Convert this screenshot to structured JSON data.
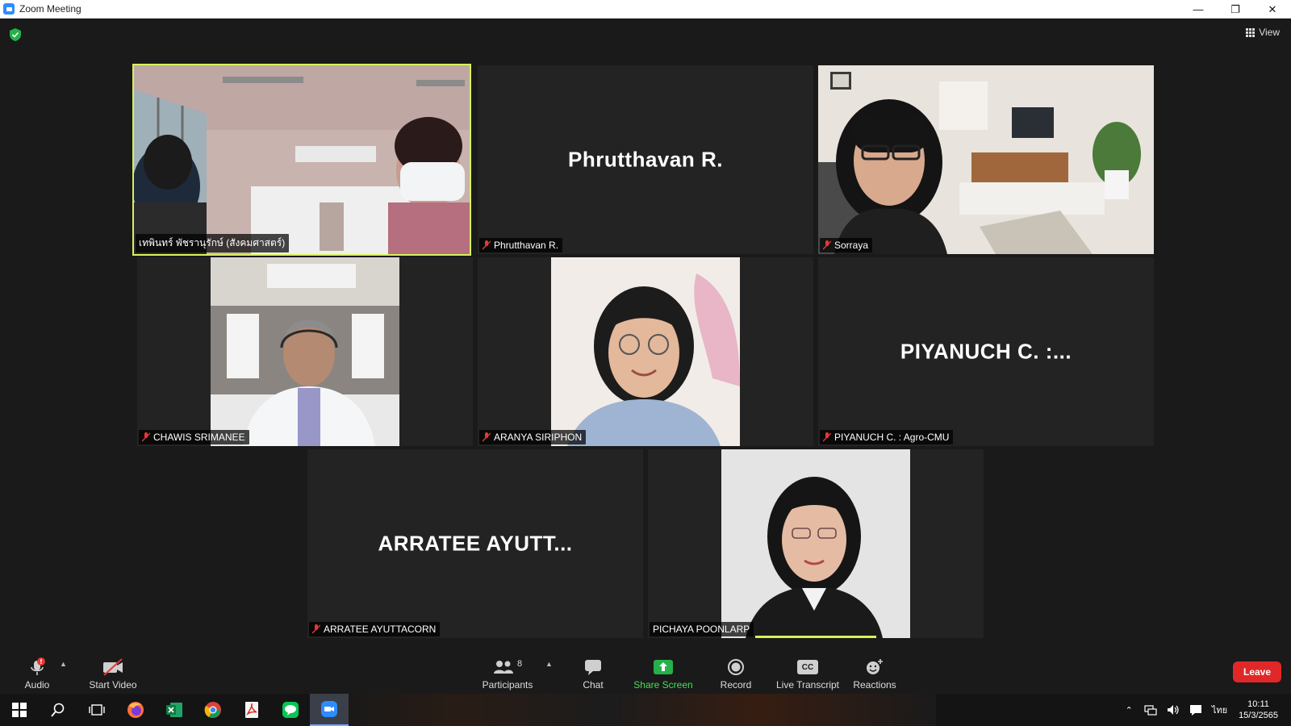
{
  "window": {
    "title": "Zoom Meeting",
    "controls": [
      "—",
      "❐",
      "✕"
    ]
  },
  "header": {
    "view_label": "View"
  },
  "participants_tiles": [
    {
      "name": "เทพินทร์ พัชรานุรักษ์ (สังคมศาสตร์)",
      "video": true,
      "active": true,
      "muted": false
    },
    {
      "name": "Phrutthavan R.",
      "display_name": "Phrutthavan R.",
      "video": false,
      "muted": true
    },
    {
      "name": "Sorraya",
      "video": true,
      "muted": true
    },
    {
      "name": "CHAWIS SRIMANEE",
      "video": true,
      "muted": true
    },
    {
      "name": "ARANYA SIRIPHON",
      "video": true,
      "muted": true
    },
    {
      "name": "PIYANUCH C. :  Agro-CMU",
      "display_name": "PIYANUCH C. :...",
      "video": false,
      "muted": true
    },
    {
      "name": "ARRATEE AYUTTACORN",
      "display_name": "ARRATEE AYUTT...",
      "video": false,
      "muted": true
    },
    {
      "name": "PICHAYA POONLARP",
      "video": true,
      "muted": false
    }
  ],
  "toolbar": {
    "audio_label": "Audio",
    "audio_badge": "!",
    "video_label": "Start Video",
    "participants_label": "Participants",
    "participants_count": "8",
    "chat_label": "Chat",
    "share_label": "Share Screen",
    "record_label": "Record",
    "transcript_label": "Live Transcript",
    "transcript_icon_text": "CC",
    "reactions_label": "Reactions",
    "leave_label": "Leave"
  },
  "taskbar": {
    "apps": [
      "windows-start",
      "search",
      "task-view",
      "firefox",
      "excel",
      "chrome",
      "acrobat",
      "line",
      "zoom"
    ],
    "ime": "ไทย",
    "time": "10:11",
    "date": "15/3/2565"
  },
  "colors": {
    "active_speaker": "#d6f25a",
    "leave": "#e02828",
    "share": "#4ade58",
    "accent": "#2d8cff"
  }
}
